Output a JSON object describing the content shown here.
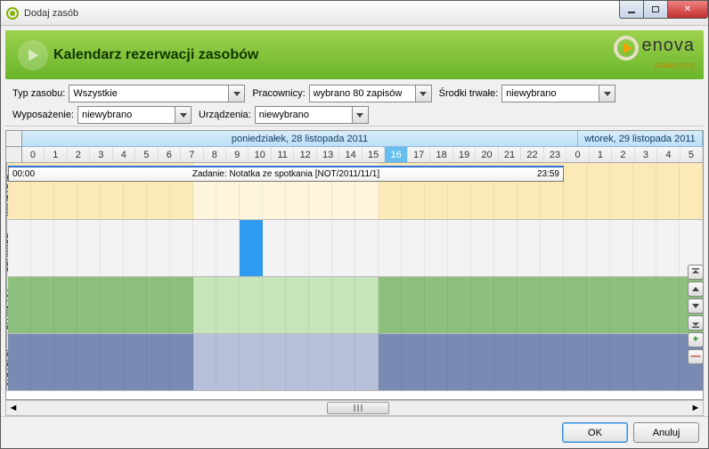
{
  "window": {
    "title": "Dodaj zasób"
  },
  "banner": {
    "heading": "Kalendarz rezerwacji zasobów",
    "brand": "enova",
    "brand_sub": "pakiet zloty"
  },
  "filters": {
    "typ_label": "Typ zasobu:",
    "typ_value": "Wszystkie",
    "prac_label": "Pracownicy:",
    "prac_value": "wybrano 80 zapisów",
    "srodki_label": "Środki trwałe:",
    "srodki_value": "niewybrano",
    "wypos_label": "Wyposażenie:",
    "wypos_value": "niewybrano",
    "urz_label": "Urządzenia:",
    "urz_value": "niewybrano"
  },
  "calendar": {
    "day1": "poniedziałek, 28 listopada 2011",
    "day2": "wtorek, 29 listopada 2011",
    "hours_day1": [
      "0",
      "1",
      "2",
      "3",
      "4",
      "5",
      "6",
      "7",
      "8",
      "9",
      "10",
      "11",
      "12",
      "13",
      "14",
      "15",
      "16",
      "17",
      "18",
      "19",
      "20",
      "21",
      "22",
      "23"
    ],
    "hours_day2": [
      "0",
      "1",
      "2",
      "3",
      "4",
      "5"
    ],
    "current_hour_index": 16,
    "rows": [
      {
        "label": "ANDRZEJE…"
      },
      {
        "label": "BEDNARE…"
      },
      {
        "label": "BUJAK DO…"
      },
      {
        "label": "STRZELEC…"
      }
    ],
    "task": {
      "start": "00:00",
      "title": "Zadanie: Notatka ze spotkania [NOT/2011/11/1]",
      "end": "23:59"
    },
    "row2_busy_start": 10,
    "row2_busy_end": 11,
    "work_start": 8,
    "work_end": 16
  },
  "sidebtns": {
    "plus": "+",
    "minus": "—"
  },
  "footer": {
    "ok": "OK",
    "cancel": "Anuluj"
  }
}
